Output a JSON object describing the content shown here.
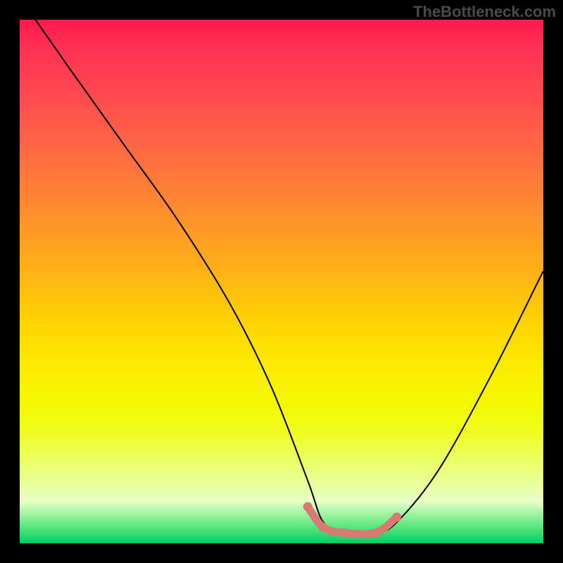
{
  "watermark": "TheBottleneck.com",
  "chart_data": {
    "type": "line",
    "title": "",
    "xlabel": "",
    "ylabel": "",
    "xlim": [
      0,
      100
    ],
    "ylim": [
      0,
      100
    ],
    "background_gradient": [
      "#ff1a4f",
      "#ffd400",
      "#00cc66"
    ],
    "series": [
      {
        "name": "bottleneck-curve",
        "color": "#000000",
        "x": [
          3,
          10,
          20,
          30,
          40,
          48,
          55,
          58,
          62,
          68,
          72,
          80,
          90,
          100
        ],
        "y": [
          100,
          90,
          76,
          62,
          46,
          30,
          12,
          4,
          2,
          2,
          4,
          14,
          32,
          52
        ]
      },
      {
        "name": "optimal-range-highlight",
        "color": "#d77a72",
        "x": [
          55,
          58,
          62,
          68,
          72
        ],
        "y": [
          7,
          3,
          2,
          2,
          5
        ]
      }
    ]
  }
}
